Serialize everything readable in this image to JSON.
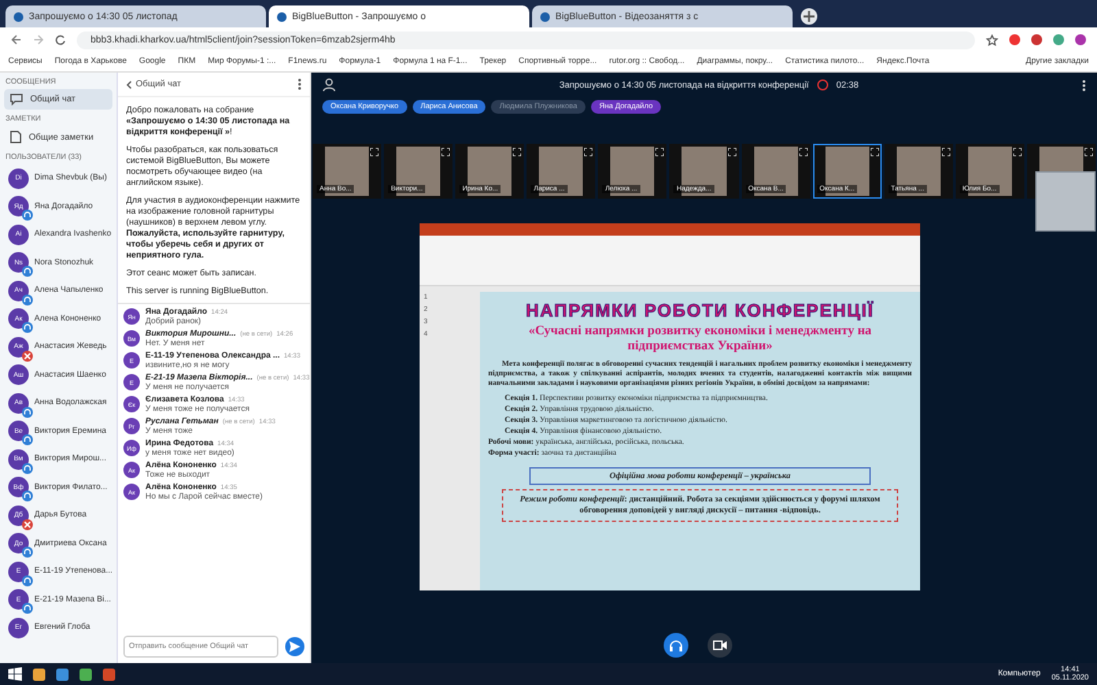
{
  "browser": {
    "tabs": [
      {
        "title": "Запрошуємо о 14:30 05 листопад",
        "selected": false
      },
      {
        "title": "BigBlueButton - Запрошуємо о",
        "selected": true
      },
      {
        "title": "BigBlueButton - Відеозаняття з с",
        "selected": false
      }
    ],
    "url": "bbb3.khadi.kharkov.ua/html5client/join?sessionToken=6mzab2sjerm4hb",
    "bookmarks": [
      "Сервисы",
      "Погода в Харькове",
      "Google",
      "ПКМ",
      "Мир Форумы-1 :...",
      "F1news.ru",
      "Формула-1",
      "Формула 1 на F-1...",
      "Трекер",
      "Спортивный торре...",
      "rutor.org :: Свобод...",
      "Диаграммы, покру...",
      "Статистика пилото...",
      "Яндекс.Почта"
    ],
    "other_bookmarks": "Другие закладки"
  },
  "sidebar": {
    "messages_heading": "СООБЩЕНИЯ",
    "chat_item": {
      "label": "Общий чат",
      "selected": true
    },
    "notes_heading": "ЗАМЕТКИ",
    "notes_item": "Общие заметки",
    "users_heading": "ПОЛЬЗОВАТЕЛИ (33)",
    "users": [
      {
        "name": "Dima Shevbuk (Вы)",
        "initials": "Di",
        "in_audio": false
      },
      {
        "name": "Яна Догадайло",
        "initials": "Яд",
        "in_audio": true,
        "muted": false
      },
      {
        "name": "Alexandra Ivashenko",
        "initials": "Ai",
        "in_audio": false
      },
      {
        "name": "Nora Stonozhuk",
        "initials": "Ns",
        "in_audio": true,
        "muted": false
      },
      {
        "name": "Алена Чапыленко",
        "initials": "Ач",
        "in_audio": true,
        "muted": false
      },
      {
        "name": "Алена Кононенко",
        "initials": "Ак",
        "in_audio": true,
        "muted": false
      },
      {
        "name": "Анастасия Жеведь",
        "initials": "Аж",
        "in_audio": true,
        "muted": true
      },
      {
        "name": "Анастасия Шаенко",
        "initials": "Аш",
        "in_audio": false
      },
      {
        "name": "Анна Водолажская",
        "initials": "Ав",
        "in_audio": true,
        "muted": false
      },
      {
        "name": "Виктория Еремина",
        "initials": "Ве",
        "in_audio": true,
        "muted": false
      },
      {
        "name": "Виктория Мирош...",
        "initials": "Вм",
        "in_audio": true,
        "muted": false
      },
      {
        "name": "Виктория Филато...",
        "initials": "Вф",
        "in_audio": true,
        "muted": false
      },
      {
        "name": "Дарья Бутова",
        "initials": "Дб",
        "in_audio": true,
        "muted": true
      },
      {
        "name": "Дмитриева Оксана",
        "initials": "До",
        "in_audio": true,
        "muted": false
      },
      {
        "name": "Е-11-19 Утепенова...",
        "initials": "Е",
        "in_audio": true,
        "muted": false
      },
      {
        "name": "Е-21-19 Мазепа Ві...",
        "initials": "Е",
        "in_audio": true,
        "muted": false
      },
      {
        "name": "Евгений Глоба",
        "initials": "Ег",
        "in_audio": false
      }
    ]
  },
  "chat": {
    "title": "Общий чат",
    "welcome": [
      "Добро пожаловать на собрание **«Запрошуємо о 14:30 05 листопада на відкриття конференції »**!",
      "Чтобы разобраться, как пользоваться системой BigBlueButton, Вы можете посмотреть обучающее видео (на английском языке).",
      "Для участия в аудиоконференции нажмите на изображение головной гарнитуры (наушников) в верхнем левом углу. **Пожалуйста, используйте гарнитуру, чтобы уберечь себя и других от неприятного гула.**",
      "Этот сеанс может быть записан."
    ],
    "server_note": "This server is running BigBlueButton.",
    "messages": [
      {
        "name": "Яна Догадайло",
        "initials": "Ян",
        "time": "14:24",
        "text": "Добрий ранок)",
        "offline": false
      },
      {
        "name": "Виктория Мирошни...",
        "initials": "Вм",
        "status": "(не в сети)",
        "time": "14:26",
        "text": "Нет. У меня нет",
        "offline": true
      },
      {
        "name": "Е-11-19 Утепенова Олександра ...",
        "initials": "Е",
        "time": "14:33",
        "text": "извините,но я не могу",
        "offline": false
      },
      {
        "name": "Е-21-19 Мазепа Вікторія...",
        "initials": "Е",
        "status": "(не в сети)",
        "time": "14:33",
        "text": "У меня не получается",
        "offline": true
      },
      {
        "name": "Єлизавета Козлова",
        "initials": "Єк",
        "time": "14:33",
        "text": "У меня тоже не получается",
        "offline": false
      },
      {
        "name": "Руслана Гетьман",
        "initials": "Рг",
        "status": "(не в сети)",
        "time": "14:33",
        "text": "У меня тоже",
        "offline": true
      },
      {
        "name": "Ирина Федотова",
        "initials": "Иф",
        "time": "14:34",
        "text": "у меня тоже нет видео)",
        "offline": false
      },
      {
        "name": "Алёна Кононенко",
        "initials": "Ак",
        "time": "14:34",
        "text": "Тоже не выходит",
        "offline": false
      },
      {
        "name": "Алёна Кононенко",
        "initials": "Ак",
        "time": "14:35",
        "text": "Но мы с Ларой сейчас вместе)",
        "offline": false
      }
    ],
    "input": {
      "placeholder": "Отправить сообщение Общий чат"
    }
  },
  "meeting": {
    "title": "Запрошуємо о 14:30 05 листопада на відкриття конференції",
    "timer": "02:38",
    "talkers": [
      {
        "name": "Оксана Криворучко",
        "active": true
      },
      {
        "name": "Лариса Анисова",
        "active": true
      },
      {
        "name": "Людмила Плужникова",
        "active": false
      },
      {
        "name": "Яна Догадайло",
        "active": true
      }
    ],
    "videos": [
      {
        "label": "Анна Во...",
        "talking": false
      },
      {
        "label": "Виктори...",
        "talking": false
      },
      {
        "label": "Ирина Ко...",
        "talking": false
      },
      {
        "label": "Лариса ...",
        "talking": false
      },
      {
        "label": "Лелюха ...",
        "talking": false
      },
      {
        "label": "Надежда...",
        "talking": false
      },
      {
        "label": "Оксана В...",
        "talking": false
      },
      {
        "label": "Оксана К...",
        "talking": true
      },
      {
        "label": "Татьяна ...",
        "talking": false
      },
      {
        "label": "Юлия Бо...",
        "talking": false
      },
      {
        "talking": false
      }
    ]
  },
  "slide": {
    "title": "НАПРЯМКИ РОБОТИ КОНФЕРЕНЦІЇ",
    "subtitle": "«Сучасні напрямки розвитку економіки і менеджменту на підприємствах України»",
    "goal": "Мета конференції полягає в обговоренні сучасних тенденцій і нагальних проблем розвитку економіки і менеджменту підприємства, а також у спілкуванні аспірантів, молодих вчених та студентів, налагодженні контактів між вищими навчальними закладами і науковими організаціями різних регіонів України, в обміні досвідом за напрямами:",
    "sections": [
      {
        "label": "Секція 1.",
        "text": "Перспективи розвитку економіки підприємства та підприємництва."
      },
      {
        "label": "Секція 2.",
        "text": "Управління трудовою діяльністю."
      },
      {
        "label": "Секція 3.",
        "text": "Управління маркетинговою та логістичною діяльністю."
      },
      {
        "label": "Секція 4.",
        "text": "Управління фінансовою діяльністю."
      }
    ],
    "facts": [
      {
        "label": "Робочі мови:",
        "text": "українська, англійська, російська, польська."
      },
      {
        "label": "Форма участі:",
        "text": "заочна та дистанційна"
      }
    ],
    "language_box": "**Офіційна мова** роботи конференції – українська",
    "mode_box": "*Режим роботи конференції*: дистанційний. Робота за секціями здійснюється у форумі шляхом обговорення доповідей у вигляді дискусії – питання -відповідь.",
    "thumbnails": [
      "1",
      "2",
      "3",
      "4"
    ]
  },
  "taskbar": {
    "computer": "Компьютер",
    "time": "14:41",
    "date": "05.11.2020"
  }
}
